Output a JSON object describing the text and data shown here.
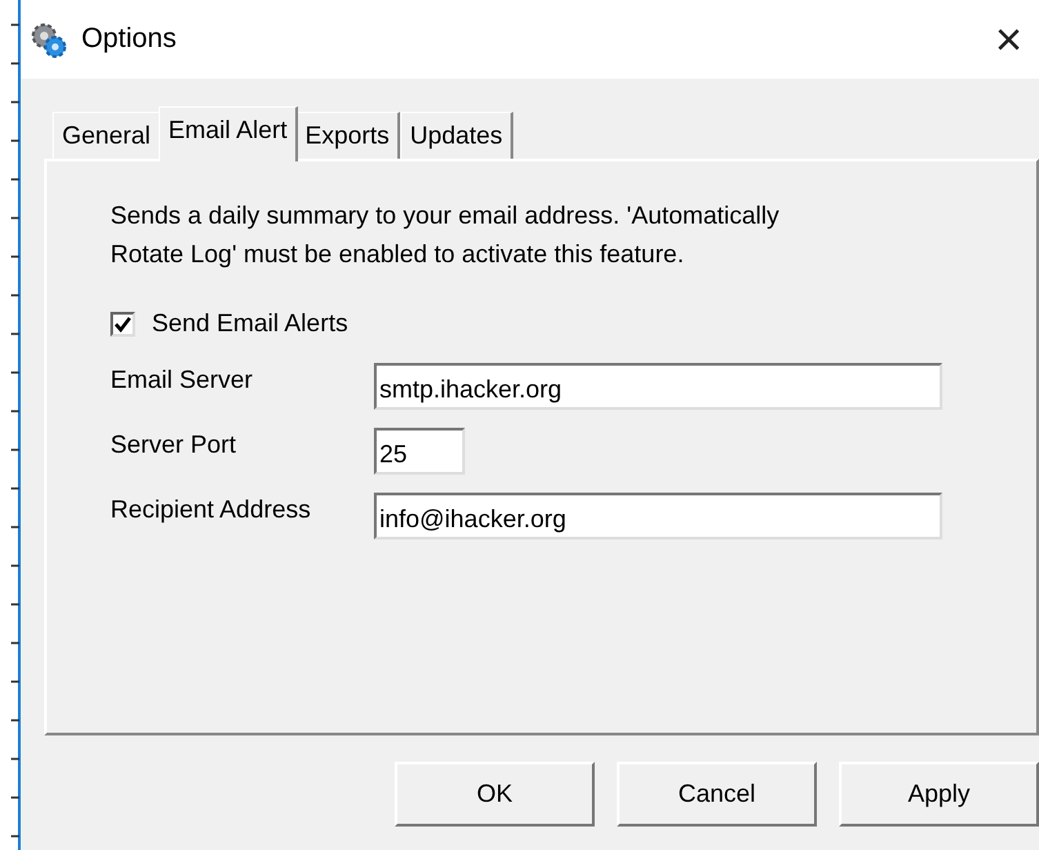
{
  "window": {
    "title": "Options",
    "close": "×"
  },
  "tabs": [
    {
      "label": "General",
      "selected": false
    },
    {
      "label": "Email Alert",
      "selected": true
    },
    {
      "label": "Exports",
      "selected": false
    },
    {
      "label": "Updates",
      "selected": false
    }
  ],
  "description": "Sends a daily summary to your email address. 'Automatically Rotate Log' must be enabled to activate this feature.",
  "send_alerts": {
    "label": "Send Email Alerts",
    "checked": true
  },
  "fields": [
    {
      "label": "Email Server",
      "value": "smtp.ihacker.org",
      "kind": "wide"
    },
    {
      "label": "Server Port",
      "value": "25",
      "kind": "short"
    },
    {
      "label": "Recipient Address",
      "value": "info@ihacker.org",
      "kind": "wide"
    }
  ],
  "buttons": [
    "OK",
    "Cancel",
    "Apply"
  ]
}
